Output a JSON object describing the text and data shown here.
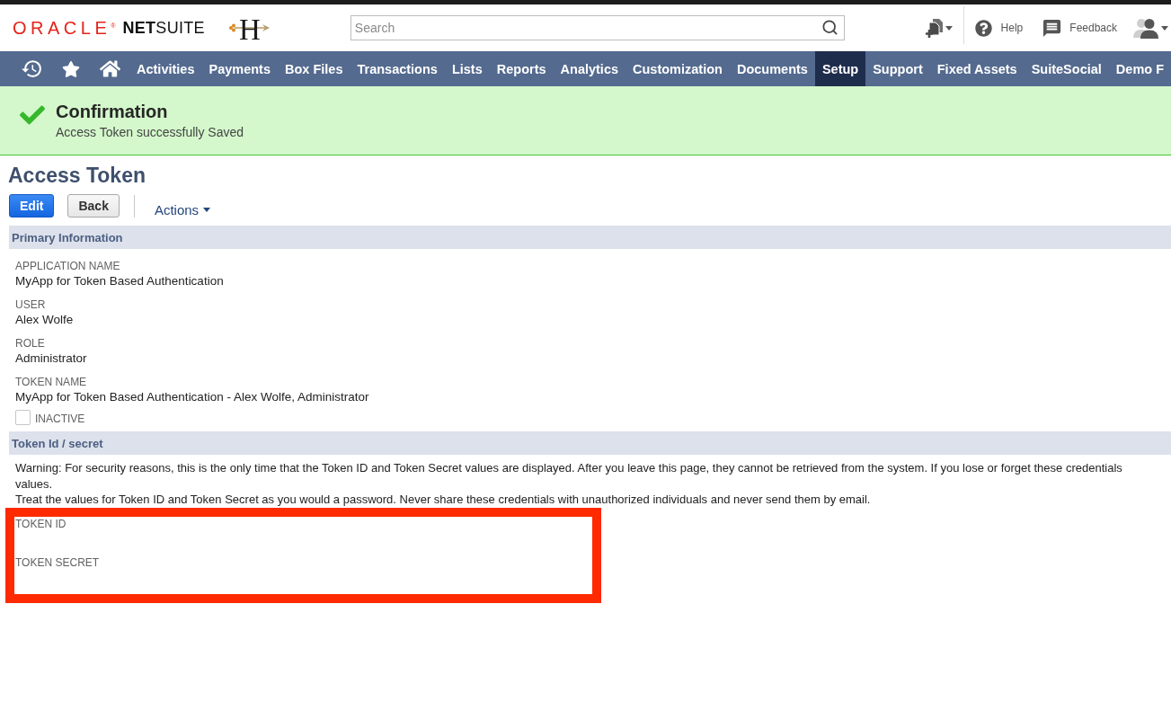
{
  "header": {
    "brand": {
      "oracle": "ORACLE$^{®}$",
      "netsuite": "**NET**SUITE"
    },
    "company_logo": {
      "letter": "H"
    },
    "search": {
      "placeholder": "Search"
    },
    "help": "Help",
    "feedback": "Feedback"
  },
  "nav": {
    "items": [
      {
        "label": "Activities",
        "selected": false
      },
      {
        "label": "Payments",
        "selected": false
      },
      {
        "label": "Box Files",
        "selected": false
      },
      {
        "label": "Transactions",
        "selected": false
      },
      {
        "label": "Lists",
        "selected": false
      },
      {
        "label": "Reports",
        "selected": false
      },
      {
        "label": "Analytics",
        "selected": false
      },
      {
        "label": "Customization",
        "selected": false
      },
      {
        "label": "Documents",
        "selected": false
      },
      {
        "label": "Setup",
        "selected": true
      },
      {
        "label": "Support",
        "selected": false
      },
      {
        "label": "Fixed Assets",
        "selected": false
      },
      {
        "label": "SuiteSocial",
        "selected": false
      },
      {
        "label": "Demo F",
        "selected": false
      }
    ]
  },
  "confirmation": {
    "title": "Confirmation",
    "message": "Access Token successfully Saved"
  },
  "page_title": "Access Token",
  "toolbar": {
    "buttons": [
      {
        "label": "Edit",
        "kind": "primary"
      },
      {
        "label": "Back",
        "kind": "secondary"
      }
    ],
    "actions_menu": "Actions"
  },
  "sections": [
    {
      "title": "Primary Information",
      "fields": [
        {
          "label": "APPLICATION NAME",
          "value": "MyApp for Token Based Authentication"
        },
        {
          "label": "USER",
          "value": "Alex Wolfe"
        },
        {
          "label": "ROLE",
          "value": "Administrator"
        },
        {
          "label": "TOKEN NAME",
          "value": "MyApp for Token Based Authentication - Alex Wolfe, Administrator"
        }
      ],
      "checkboxes": [
        {
          "label": "INACTIVE",
          "checked": false
        }
      ]
    },
    {
      "title": "Token Id / secret",
      "notes": [
        "Warning: For security reasons, this is the only time that the Token ID and Token Secret values are displayed. After you leave this page, they cannot be retrieved from the system. If you lose or forget these credentials",
        "values.",
        "Treat the values for Token ID and Token Secret as you would a password. Never share these credentials with unauthorized individuals and never send them by email."
      ],
      "highlighted_fields": [
        {
          "label": "TOKEN ID"
        },
        {
          "label": "TOKEN SECRET"
        }
      ]
    }
  ]
}
